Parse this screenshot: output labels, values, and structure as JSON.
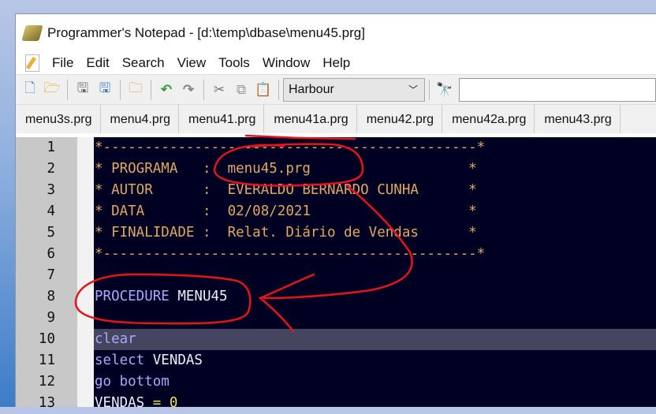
{
  "window": {
    "title": "Programmer's Notepad - [d:\\temp\\dbase\\menu45.prg]"
  },
  "menu": [
    "File",
    "Edit",
    "Search",
    "View",
    "Tools",
    "Window",
    "Help"
  ],
  "toolbar": {
    "icons": [
      "new-file-icon",
      "open-file-icon",
      "save-icon",
      "save-all-icon",
      "open-folder-icon",
      "undo-icon",
      "redo-icon",
      "cut-icon",
      "copy-icon",
      "paste-icon"
    ],
    "scheme": "Harbour"
  },
  "tabs": [
    "menu3s.prg",
    "menu4.prg",
    "menu41.prg",
    "menu41a.prg",
    "menu42.prg",
    "menu42a.prg",
    "menu43.prg"
  ],
  "editor": {
    "line_numbers": [
      "1",
      "2",
      "3",
      "4",
      "5",
      "6",
      "7",
      "8",
      "9",
      "10",
      "11",
      "12",
      "13"
    ],
    "current_line": 10,
    "lines": [
      [
        {
          "t": "*---------------------------------------------*",
          "c": "cm"
        }
      ],
      [
        {
          "t": "* PROGRAMA   :  menu45.prg                   *",
          "c": "cm"
        }
      ],
      [
        {
          "t": "* AUTOR      :  EVERALDO BERNARDO CUNHA      *",
          "c": "cm"
        }
      ],
      [
        {
          "t": "* DATA       :  02/08/2021                   *",
          "c": "cm"
        }
      ],
      [
        {
          "t": "* FINALIDADE :  Relat. Diário de Vendas      *",
          "c": "cm"
        }
      ],
      [
        {
          "t": "*---------------------------------------------*",
          "c": "cm"
        }
      ],
      [],
      [
        {
          "t": "PROCEDURE",
          "c": "kw"
        },
        {
          "t": " MENU45",
          "c": "id"
        }
      ],
      [],
      [
        {
          "t": "clear",
          "c": "kw"
        }
      ],
      [
        {
          "t": "select",
          "c": "kw"
        },
        {
          "t": " VENDAS",
          "c": "id"
        }
      ],
      [
        {
          "t": "go bottom",
          "c": "kw"
        }
      ],
      [
        {
          "t": "VENDAS",
          "c": "id"
        },
        {
          "t": " = ",
          "c": "op"
        },
        {
          "t": "0",
          "c": "num"
        }
      ]
    ]
  },
  "colors": {
    "annotation": "#e8141c",
    "editor_bg": "#000022",
    "comment": "#e0a866"
  }
}
